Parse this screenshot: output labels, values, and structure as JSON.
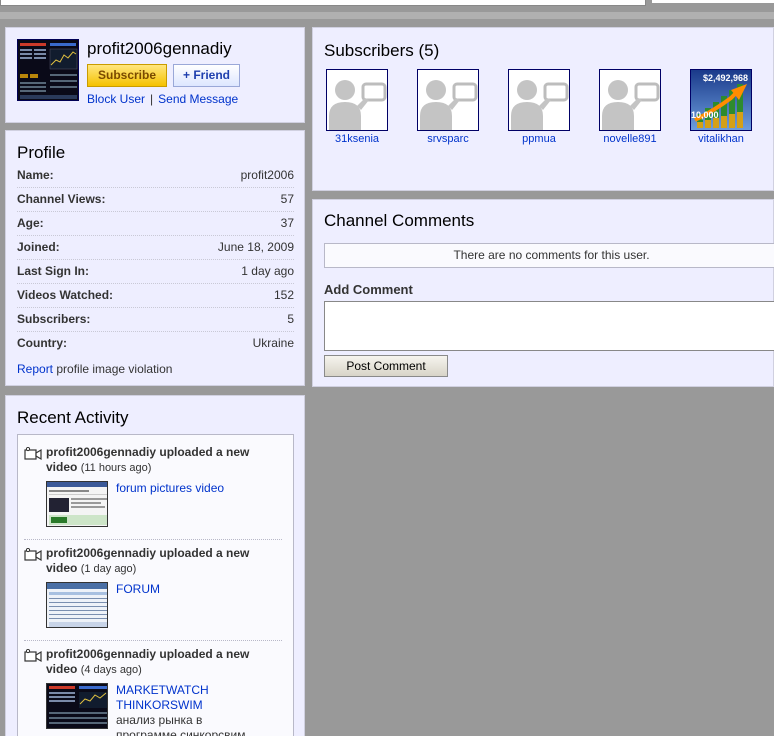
{
  "user": {
    "username": "profit2006gennadiy",
    "subscribe_label": "Subscribe",
    "friend_label": "+ Friend",
    "block_label": "Block User",
    "separator": "|",
    "message_label": "Send Message"
  },
  "profile": {
    "title": "Profile",
    "rows": [
      {
        "key": "Name:",
        "value": "profit2006"
      },
      {
        "key": "Channel Views:",
        "value": "57"
      },
      {
        "key": "Age:",
        "value": "37"
      },
      {
        "key": "Joined:",
        "value": "June 18, 2009"
      },
      {
        "key": "Last Sign In:",
        "value": "1 day ago"
      },
      {
        "key": "Videos Watched:",
        "value": "152"
      },
      {
        "key": "Subscribers:",
        "value": "5"
      },
      {
        "key": "Country:",
        "value": "Ukraine"
      }
    ],
    "report_link": "Report",
    "report_text": " profile image violation"
  },
  "activity": {
    "title": "Recent Activity",
    "items": [
      {
        "text": "profit2006gennadiy uploaded a new video",
        "when": "(11 hours ago)",
        "video_title": "forum pictures video",
        "video_desc": ""
      },
      {
        "text": "profit2006gennadiy uploaded a new video",
        "when": "(1 day ago)",
        "video_title": "FORUM",
        "video_desc": ""
      },
      {
        "text": "profit2006gennadiy uploaded a new video",
        "when": "(4 days ago)",
        "video_title": "MARKETWATCH THINKORSWIM",
        "video_desc": "анализ рынка в программе синкорсвим"
      }
    ]
  },
  "subscribers": {
    "title": "Subscribers (5)",
    "items": [
      {
        "name": "31ksenia",
        "avatar": "default-avatar-icon"
      },
      {
        "name": "srvsparc",
        "avatar": "default-avatar-icon"
      },
      {
        "name": "ppmua",
        "avatar": "default-avatar-icon"
      },
      {
        "name": "novelle891",
        "avatar": "default-avatar-icon"
      },
      {
        "name": "vitalikhan",
        "avatar": "money-chart-image",
        "img_top": "$2,492,968",
        "img_left": "10,000"
      }
    ]
  },
  "comments": {
    "title": "Channel Comments",
    "empty_text": "There are no comments for this user.",
    "add_label": "Add Comment",
    "input_value": "",
    "post_label": "Post Comment"
  },
  "colors": {
    "panel_bg": "#eeeeff",
    "page_bg": "#999999",
    "link": "#0033cc",
    "subscribe_bg": "#f5c200"
  }
}
